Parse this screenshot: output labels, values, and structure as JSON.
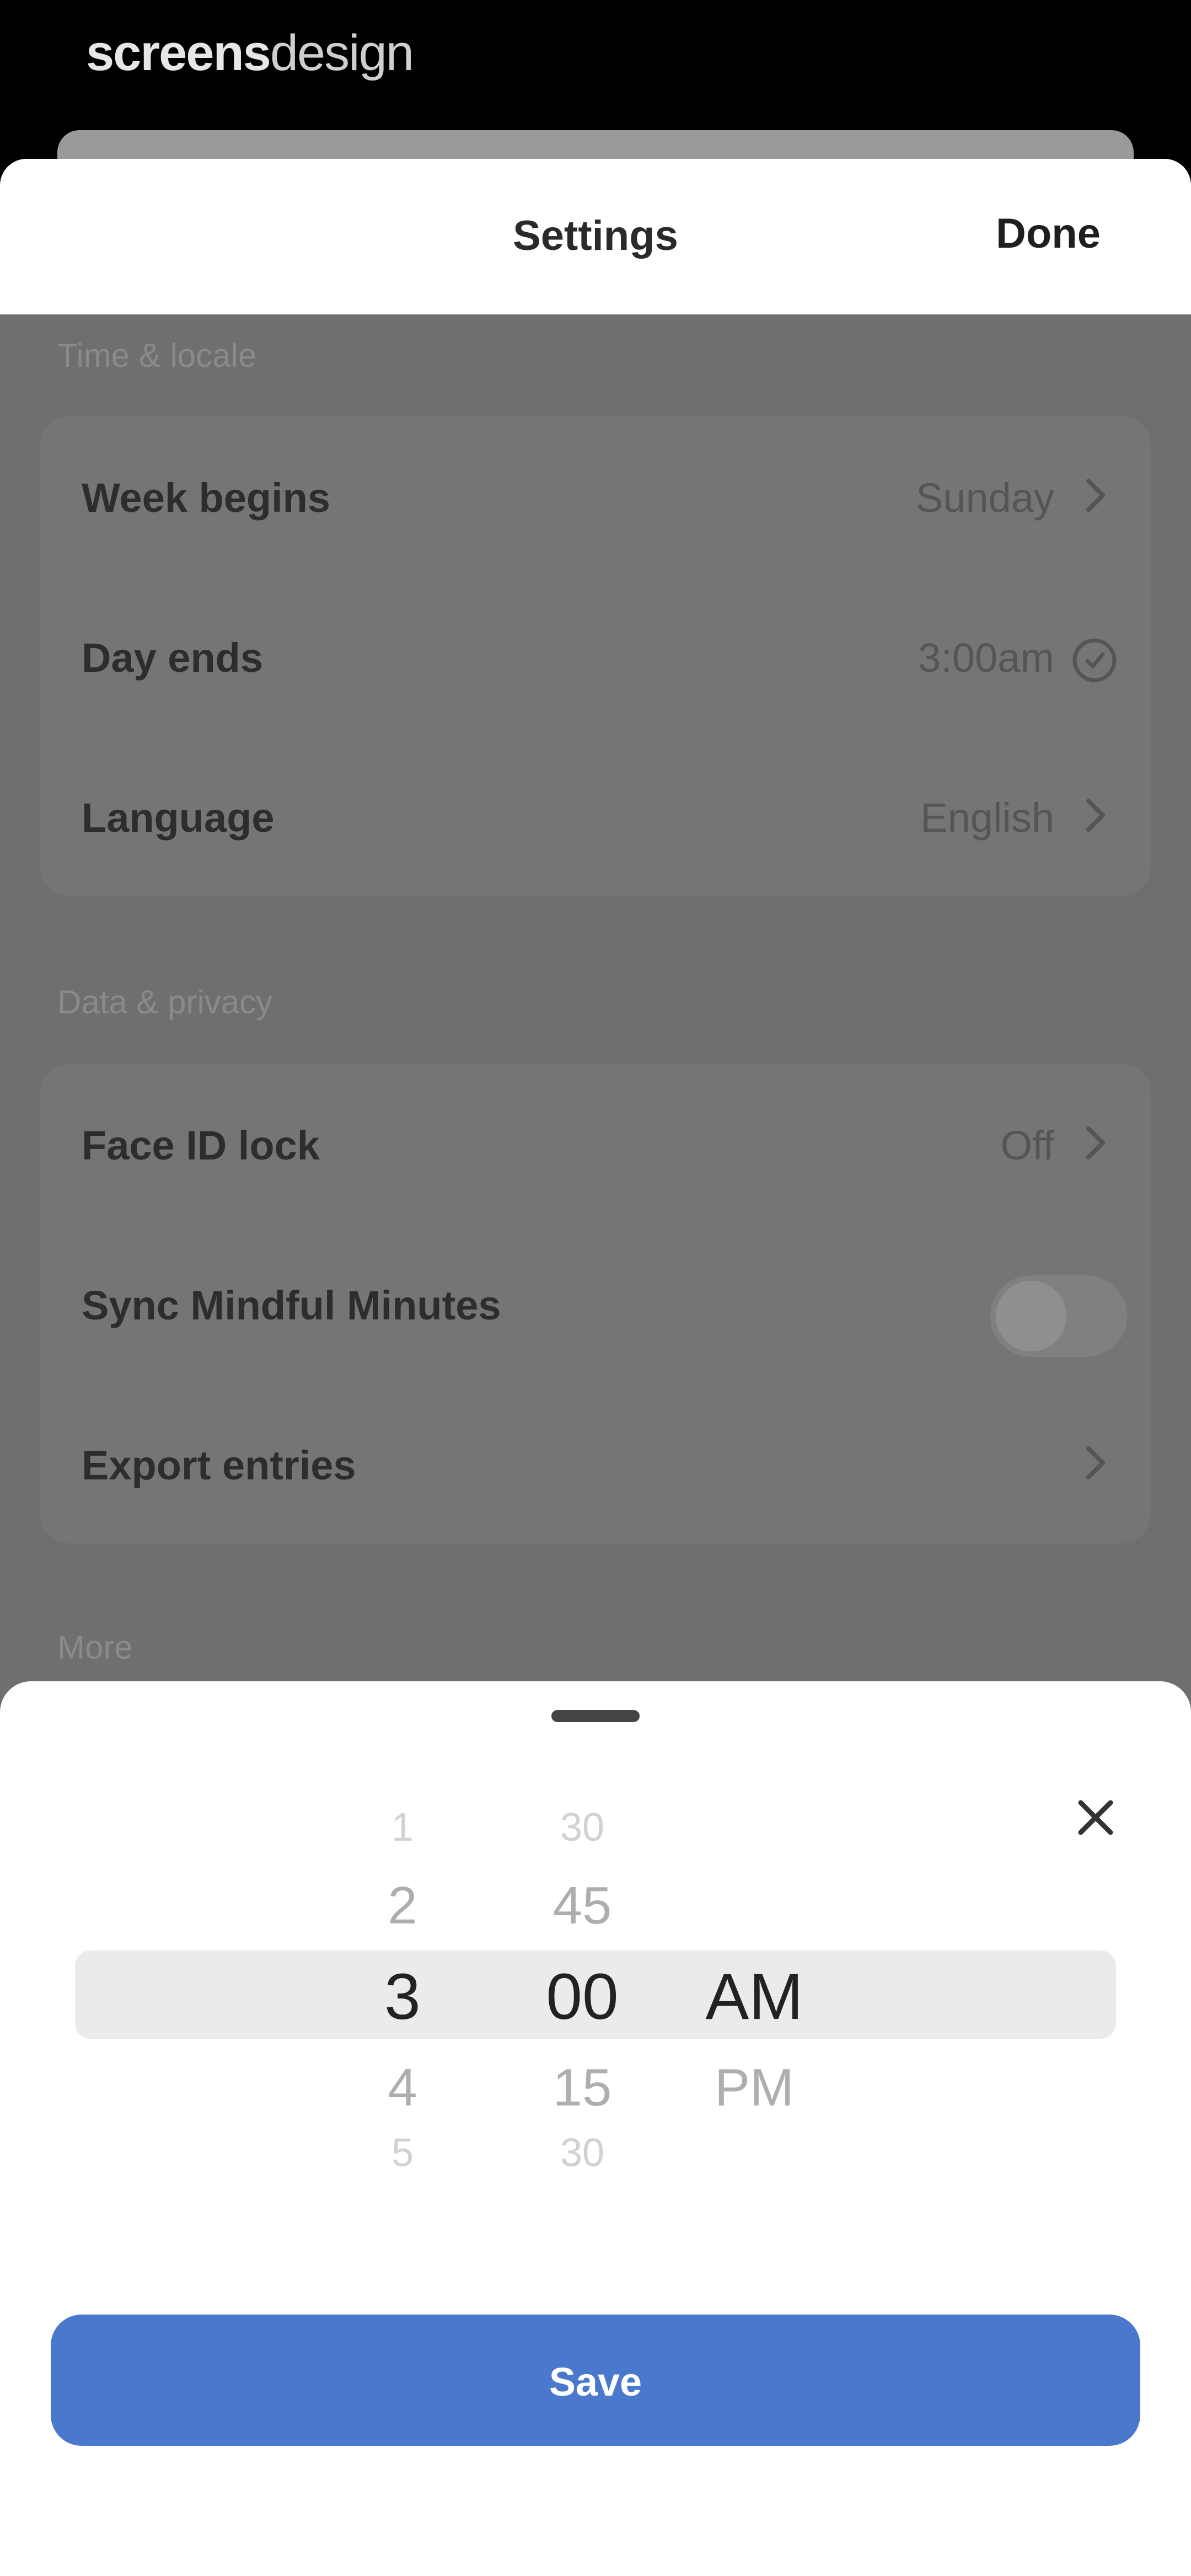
{
  "watermark": {
    "bold": "screens",
    "light": "design"
  },
  "header": {
    "title": "Settings",
    "done_label": "Done"
  },
  "sections": [
    {
      "title": "Time & locale",
      "rows": [
        {
          "label": "Week begins",
          "value": "Sunday",
          "accessory": "chevron-right-icon"
        },
        {
          "label": "Day ends",
          "value": "3:00am",
          "accessory": "clock-icon"
        },
        {
          "label": "Language",
          "value": "English",
          "accessory": "chevron-right-icon"
        }
      ]
    },
    {
      "title": "Data & privacy",
      "rows": [
        {
          "label": "Face ID lock",
          "value": "Off",
          "accessory": "chevron-right-icon"
        },
        {
          "label": "Sync Mindful Minutes",
          "value": "",
          "accessory": "toggle",
          "toggle_on": false
        },
        {
          "label": "Export entries",
          "value": "",
          "accessory": "chevron-right-icon"
        }
      ]
    },
    {
      "title": "More"
    }
  ],
  "time_picker": {
    "hours": [
      "1",
      "2",
      "3",
      "4",
      "5"
    ],
    "minutes": [
      "30",
      "45",
      "00",
      "15",
      "30"
    ],
    "periods": [
      "AM",
      "PM"
    ],
    "selected": {
      "hour": "3",
      "minute": "00",
      "period": "AM"
    },
    "save_label": "Save"
  },
  "colors": {
    "save_button": "#4a78cc",
    "dim_overlay": "#6f6f6f"
  }
}
